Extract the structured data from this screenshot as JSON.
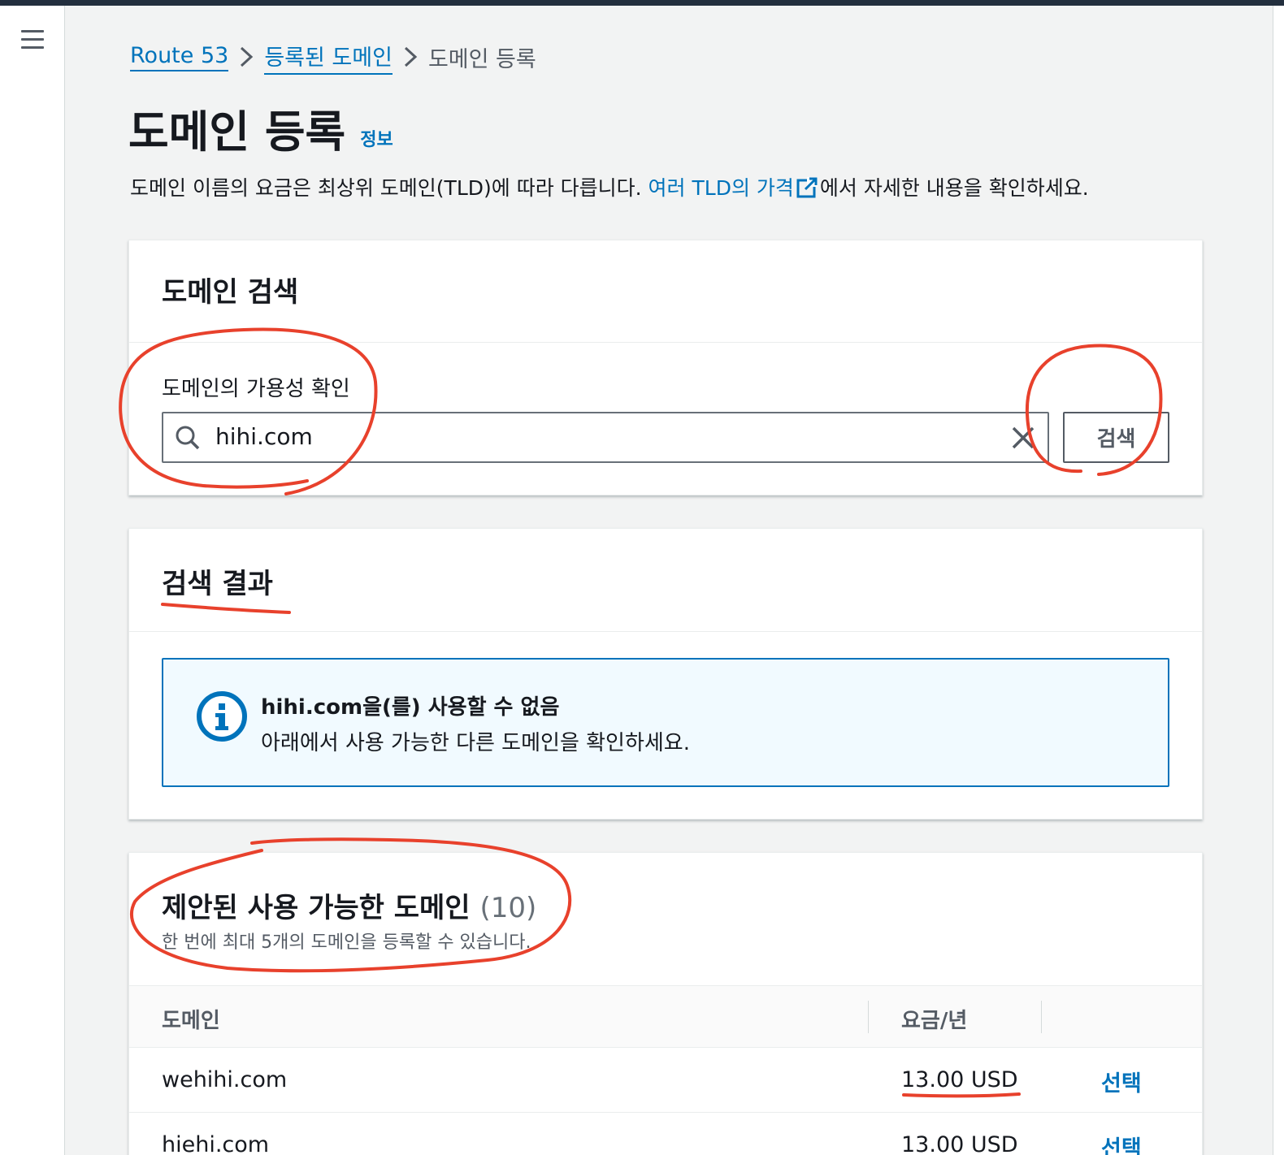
{
  "breadcrumb": {
    "items": [
      {
        "label": "Route 53"
      },
      {
        "label": "등록된 도메인"
      },
      {
        "label": "도메인 등록"
      }
    ]
  },
  "page": {
    "title": "도메인 등록",
    "info_label": "정보",
    "description_prefix": "도메인 이름의 요금은 최상위 도메인(TLD)에 따라 다릅니다. ",
    "description_link": "여러 TLD의 가격",
    "description_suffix": "에서 자세한 내용을 확인하세요."
  },
  "search_panel": {
    "title": "도메인 검색",
    "field_label": "도메인의 가용성 확인",
    "search_value": "hihi.com",
    "search_button": "검색"
  },
  "results_panel": {
    "title": "검색 결과",
    "alert_title": "hihi.com을(를) 사용할 수 없음",
    "alert_body": "아래에서 사용 가능한 다른 도메인을 확인하세요."
  },
  "suggested_panel": {
    "title": "제안된 사용 가능한 도메인",
    "count": "(10)",
    "subtitle": "한 번에 최대 5개의 도메인을 등록할 수 있습니다.",
    "columns": [
      "도메인",
      "요금/년"
    ],
    "rows": [
      {
        "domain": "wehihi.com",
        "price": "13.00 USD",
        "action": "선택"
      },
      {
        "domain": "hiehi.com",
        "price": "13.00 USD",
        "action": "선택"
      }
    ]
  },
  "colors": {
    "link": "#0073bb",
    "annotation": "#e8412c",
    "alert_bg": "#f1faff"
  }
}
